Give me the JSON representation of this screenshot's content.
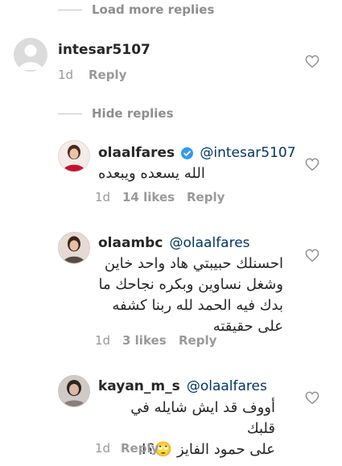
{
  "load_more": "Load more replies",
  "hide_replies": "Hide replies",
  "comments": [
    {
      "username": "intesar5107",
      "mention": "",
      "text": [],
      "time": "1d",
      "likes": "",
      "reply": "Reply"
    },
    {
      "username": "olaalfares",
      "mention": "@intesar5107",
      "text": [
        "الله يسعده ويبعده"
      ],
      "time": "1d",
      "likes": "14 likes",
      "reply": "Reply"
    },
    {
      "username": "olaambc",
      "mention": "@olaalfares",
      "text": [
        "احسنلك حبيبتي هاد واحد خاين",
        "وشغل نساوين وبكره نجاحك ما",
        "بدك فيه الحمد لله ربنا كشفه",
        "على حقيقته"
      ],
      "time": "1d",
      "likes": "3 likes",
      "reply": "Reply"
    },
    {
      "username": "kayan_m_s",
      "mention": "@olaalfares",
      "text": [
        "أووف قد ايش شايله في قلبك",
        "على حمود الفايز 🙄؟!"
      ],
      "time": "1d",
      "likes": "",
      "reply": "Reply"
    }
  ]
}
